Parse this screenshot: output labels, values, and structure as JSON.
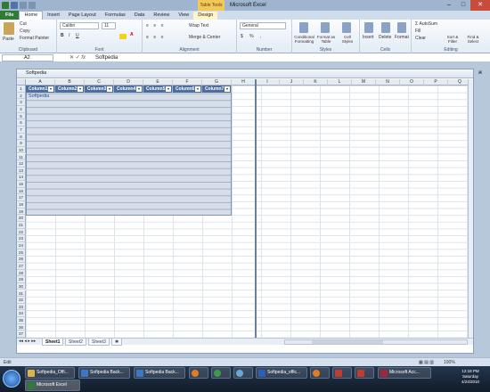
{
  "window": {
    "title": "Microsoft Excel",
    "context_tab": "Table Tools"
  },
  "tabs": [
    "File",
    "Home",
    "Insert",
    "Page Layout",
    "Formulas",
    "Data",
    "Review",
    "View",
    "Design"
  ],
  "ribbon": {
    "clipboard": {
      "label": "Clipboard",
      "paste": "Paste",
      "cut": "Cut",
      "copy": "Copy",
      "format_painter": "Format Painter"
    },
    "font": {
      "label": "Font",
      "name": "Calibri",
      "size": "11"
    },
    "alignment": {
      "label": "Alignment",
      "wrap": "Wrap Text",
      "merge": "Merge & Center"
    },
    "number": {
      "label": "Number",
      "format": "General"
    },
    "styles": {
      "label": "Styles",
      "cond": "Conditional Formatting",
      "table": "Format as Table",
      "cell": "Cell Styles"
    },
    "cells": {
      "label": "Cells",
      "insert": "Insert",
      "delete": "Delete",
      "format": "Format"
    },
    "editing": {
      "label": "Editing",
      "autosum": "AutoSum",
      "fill": "Fill",
      "clear": "Clear",
      "sort": "Sort & Filter",
      "find": "Find & Select"
    }
  },
  "formula_bar": {
    "name_box": "A2",
    "fx": "fx",
    "value": "Softpedia"
  },
  "workbook": {
    "title": "Softpedia"
  },
  "columns": [
    "A",
    "B",
    "C",
    "D",
    "E",
    "F",
    "G",
    "H",
    "I",
    "J",
    "K",
    "L",
    "M",
    "N",
    "O",
    "P",
    "Q"
  ],
  "rows": [
    "1",
    "2",
    "3",
    "4",
    "5",
    "6",
    "7",
    "8",
    "9",
    "10",
    "11",
    "12",
    "13",
    "14",
    "15",
    "16",
    "17",
    "18",
    "19",
    "20",
    "21",
    "22",
    "23",
    "24",
    "25",
    "26",
    "27",
    "28",
    "29",
    "30",
    "31",
    "32",
    "33",
    "34",
    "35",
    "36",
    "37"
  ],
  "table_headers": [
    "Column1",
    "Column2",
    "Column3",
    "Column4",
    "Column5",
    "Column6",
    "Column7"
  ],
  "cell_a2": "Softpedia",
  "sheets": [
    "Sheet1",
    "Sheet2",
    "Sheet3"
  ],
  "status": {
    "mode": "Edit",
    "zoom": "100%"
  },
  "taskbar": {
    "items": [
      "Softpedia_Offi...",
      "Softpedia Back...",
      "Softpedia Back...",
      "Softpedia_offic...",
      "Microsoft Acc...",
      "Microsoft Excel"
    ],
    "time": "12:18 PM",
    "day": "Saturday",
    "date": "4/24/2010"
  }
}
